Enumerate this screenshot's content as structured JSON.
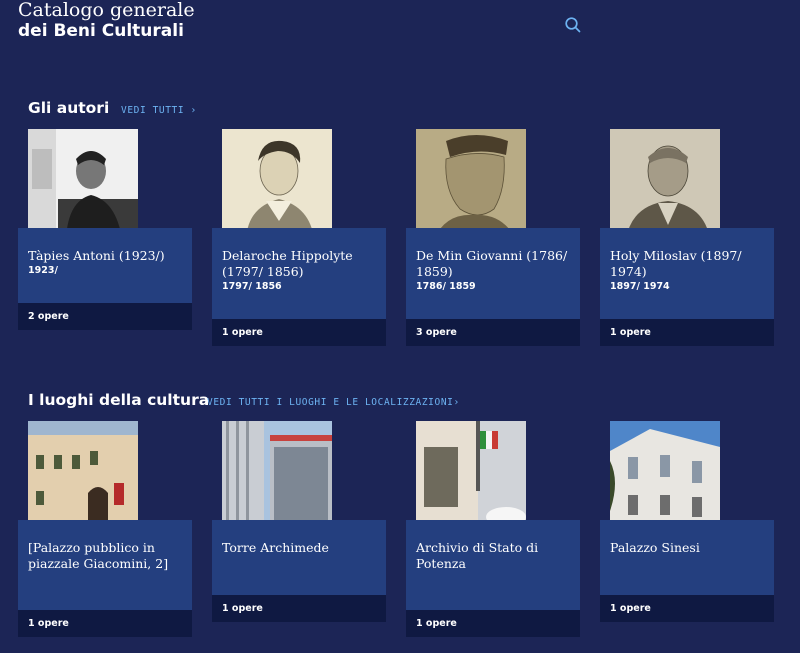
{
  "header": {
    "title_line1": "Catalogo generale",
    "title_line2": "dei Beni Culturali"
  },
  "authors": {
    "title": "Gli autori",
    "link": "VEDI TUTTI ›",
    "cards": [
      {
        "name": "Tàpies Antoni (1923/)",
        "dates": "1923/",
        "count": "2 opere"
      },
      {
        "name": "Delaroche Hippolyte (1797/ 1856)",
        "dates": "1797/ 1856",
        "count": "1 opere"
      },
      {
        "name": "De Min Giovanni (1786/ 1859)",
        "dates": "1786/ 1859",
        "count": "3 opere"
      },
      {
        "name": "Holy Miloslav (1897/ 1974)",
        "dates": "1897/ 1974",
        "count": "1 opere"
      }
    ]
  },
  "places": {
    "title": "I luoghi della cultura",
    "link": "VEDI TUTTI I LUOGHI E LE LOCALIZZAZIONI›",
    "cards": [
      {
        "name": "[Palazzo pubblico in piazzale Giacomini, 2]",
        "count": "1 opere"
      },
      {
        "name": "Torre Archimede",
        "count": "1 opere"
      },
      {
        "name": "Archivio di Stato di Potenza",
        "count": "1 opere"
      },
      {
        "name": "Palazzo Sinesi",
        "count": "1 opere"
      }
    ]
  },
  "colors": {
    "background": "#1c2556",
    "card": "#243f7f",
    "card_footer": "#0f1942",
    "link": "#6db3f2"
  },
  "icons": [
    "search-icon"
  ]
}
